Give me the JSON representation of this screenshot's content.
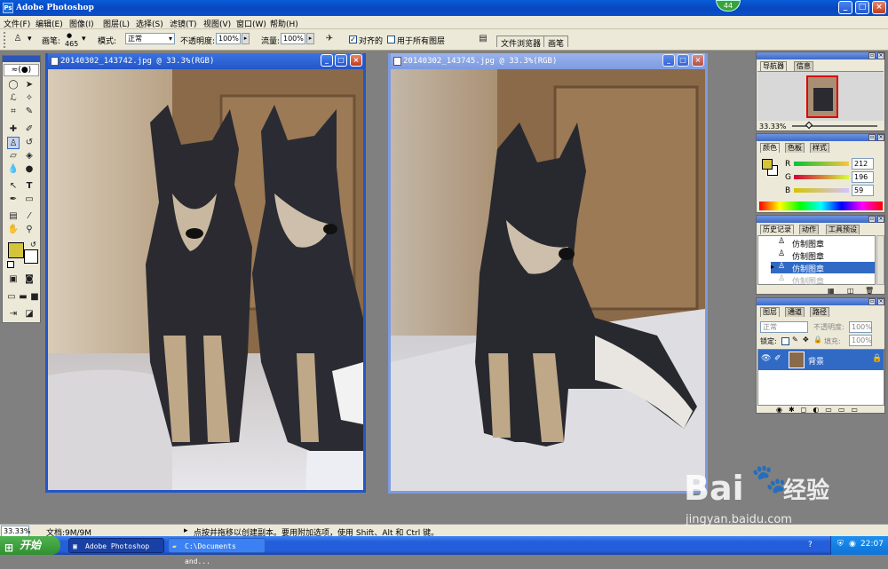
{
  "app": {
    "title": "Adobe Photoshop",
    "badge": "44"
  },
  "menu": [
    "文件(F)",
    "编辑(E)",
    "图像(I)",
    "图层(L)",
    "选择(S)",
    "滤镜(T)",
    "视图(V)",
    "窗口(W)",
    "帮助(H)"
  ],
  "options": {
    "brush_label": "画笔:",
    "brush_size": "465",
    "mode_label": "模式:",
    "mode_value": "正常",
    "opacity_label": "不透明度:",
    "opacity_value": "100%",
    "flow_label": "流量:",
    "flow_value": "100%",
    "aligned_label": "对齐的",
    "all_layers_label": "用于所有图层",
    "tab_file_browser": "文件浏览器",
    "tab_brushes": "画笔"
  },
  "docs": [
    {
      "title": "20140302_143742.jpg @ 33.3%(RGB)"
    },
    {
      "title": "20140302_143745.jpg @ 33.3%(RGB)"
    }
  ],
  "navigator": {
    "tabs": [
      "导航器",
      "信息"
    ],
    "zoom": "33.33%"
  },
  "color": {
    "tabs": [
      "颜色",
      "色板",
      "样式"
    ],
    "r_label": "R",
    "r": "212",
    "g_label": "G",
    "g": "196",
    "b_label": "B",
    "b": "59",
    "fg_color": "#d4c43b"
  },
  "history": {
    "tabs": [
      "历史记录",
      "动作",
      "工具预设"
    ],
    "items": [
      {
        "label": "仿制图章",
        "state": "normal"
      },
      {
        "label": "仿制图章",
        "state": "normal"
      },
      {
        "label": "仿制图章",
        "state": "selected"
      },
      {
        "label": "仿制图章",
        "state": "dimmed"
      }
    ]
  },
  "layers": {
    "tabs": [
      "图层",
      "通道",
      "路径"
    ],
    "blend": "正常",
    "opacity_label": "不透明度:",
    "opacity": "100%",
    "lock_label": "锁定:",
    "fill_label": "填充:",
    "fill": "100%",
    "layer_name": "背景"
  },
  "status": {
    "zoom": "33.33%",
    "doc_info": "文档:9M/9M",
    "hint": "点按并拖移以创建副本。要用附加选项，使用 Shift、Alt 和 Ctrl 键。"
  },
  "taskbar": {
    "start": "开始",
    "items": [
      "Adobe Photoshop",
      "C:\\Documents and..."
    ],
    "clock": "22:07"
  },
  "watermark": {
    "brand": "Bai",
    "brand2": "经验",
    "url": "jingyan.baidu.com"
  },
  "colors": {
    "active_title": "#2456c8",
    "inactive_title": "#7d9be0",
    "selection": "#316ac5"
  }
}
